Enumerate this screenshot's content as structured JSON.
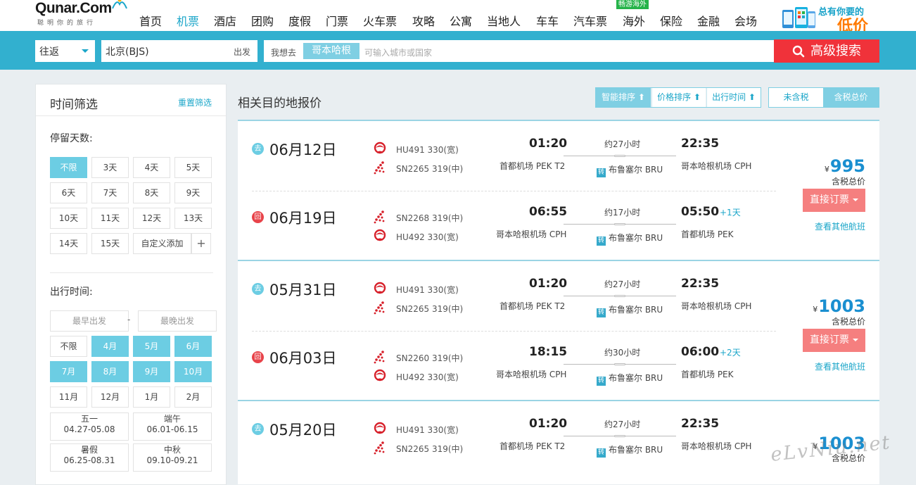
{
  "header": {
    "logo": "Qunar.Com",
    "slogan": "聪明你的旅行",
    "nav": [
      "首页",
      "机票",
      "酒店",
      "团购",
      "度假",
      "门票",
      "火车票",
      "攻略",
      "公寓",
      "当地人",
      "车车",
      "汽车票",
      "海外",
      "保险",
      "金融",
      "会场"
    ],
    "nav_active": "机票",
    "overseas_badge": "畅游海外",
    "promo_line1": "总有你要的",
    "promo_line2": "低价"
  },
  "search": {
    "trip_type": "往返",
    "from_value": "北京(BJS)",
    "from_label": "出发",
    "to_label": "我想去",
    "to_chip": "哥本哈根",
    "to_placeholder": "可输入城市或国家",
    "advanced_button": "高级搜索"
  },
  "sidebar": {
    "title": "时间筛选",
    "reset": "重置筛选",
    "stay_title": "停留天数:",
    "stay_options": [
      "不限",
      "3天",
      "4天",
      "5天",
      "6天",
      "7天",
      "8天",
      "9天",
      "10天",
      "11天",
      "12天",
      "13天",
      "14天",
      "15天"
    ],
    "stay_custom": "自定义添加",
    "stay_plus": "+",
    "depart_title": "出行时间:",
    "earliest_placeholder": "最早出发",
    "latest_placeholder": "最晚出发",
    "dash": "-",
    "month_options": [
      "不限",
      "4月",
      "5月",
      "6月",
      "7月",
      "8月",
      "9月",
      "10月",
      "11月",
      "12月",
      "1月",
      "2月"
    ],
    "holidays": [
      {
        "name": "五一",
        "range": "04.27-05.08"
      },
      {
        "name": "端午",
        "range": "06.01-06.15"
      },
      {
        "name": "暑假",
        "range": "06.25-08.31"
      },
      {
        "name": "中秋",
        "range": "09.10-09.21"
      }
    ]
  },
  "main": {
    "title": "相关目的地报价",
    "sort": [
      "智能排序 ⬆",
      "价格排序 ⬆",
      "出行时间 ⬆"
    ],
    "tax_toggle": [
      "未含税",
      "含税总价"
    ],
    "colors": {
      "accent": "#32b0cf",
      "price": "#1a8fd0",
      "book": "#f57f7f",
      "search_btn": "#f0323a"
    }
  },
  "results": [
    {
      "price_symbol": "¥",
      "price": "995",
      "price_label": "含税总价",
      "book": "直接订票",
      "other": "查看其他航班",
      "legs": [
        {
          "marker": "去",
          "date": "06月12日",
          "flights": [
            "HU491 330(宽)",
            "SN2265 319(中)"
          ],
          "dep_time": "01:20",
          "duration": "约27小时",
          "arr_time": "22:35",
          "plus_day": "",
          "dep_airport": "首都机场 PEK T2",
          "transfer_icon": "转",
          "transfer": "布鲁塞尔 BRU",
          "arr_airport": "哥本哈根机场 CPH"
        },
        {
          "marker": "回",
          "date": "06月19日",
          "flights": [
            "SN2268 319(中)",
            "HU492 330(宽)"
          ],
          "dep_time": "06:55",
          "duration": "约17小时",
          "arr_time": "05:50",
          "plus_day": "+1天",
          "dep_airport": "哥本哈根机场 CPH",
          "transfer_icon": "转",
          "transfer": "布鲁塞尔 BRU",
          "arr_airport": "首都机场 PEK"
        }
      ]
    },
    {
      "price_symbol": "¥",
      "price": "1003",
      "price_label": "含税总价",
      "book": "直接订票",
      "other": "查看其他航班",
      "legs": [
        {
          "marker": "去",
          "date": "05月31日",
          "flights": [
            "HU491 330(宽)",
            "SN2265 319(中)"
          ],
          "dep_time": "01:20",
          "duration": "约27小时",
          "arr_time": "22:35",
          "plus_day": "",
          "dep_airport": "首都机场 PEK T2",
          "transfer_icon": "转",
          "transfer": "布鲁塞尔 BRU",
          "arr_airport": "哥本哈根机场 CPH"
        },
        {
          "marker": "回",
          "date": "06月03日",
          "flights": [
            "SN2260 319(中)",
            "HU492 330(宽)"
          ],
          "dep_time": "18:15",
          "duration": "约30小时",
          "arr_time": "06:00",
          "plus_day": "+2天",
          "dep_airport": "哥本哈根机场 CPH",
          "transfer_icon": "转",
          "transfer": "布鲁塞尔 BRU",
          "arr_airport": "首都机场 PEK"
        }
      ]
    },
    {
      "price_symbol": "¥",
      "price": "1003",
      "price_label": "含税总价",
      "book": "",
      "other": "",
      "legs": [
        {
          "marker": "去",
          "date": "05月20日",
          "flights": [
            "HU491 330(宽)",
            "SN2265 319(中)"
          ],
          "dep_time": "01:20",
          "duration": "约27小时",
          "arr_time": "22:35",
          "plus_day": "",
          "dep_airport": "首都机场 PEK T2",
          "transfer_icon": "转",
          "transfer": "布鲁塞尔 BRU",
          "arr_airport": "哥本哈根机场 CPH"
        }
      ]
    }
  ],
  "watermark": "eLvNiu.net"
}
